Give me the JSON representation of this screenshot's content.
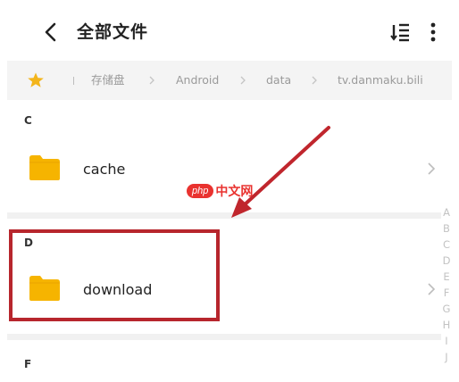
{
  "header": {
    "title": "全部文件"
  },
  "breadcrumb": {
    "items": [
      "存储盘",
      "Android",
      "data",
      "tv.danmaku.bili"
    ]
  },
  "sections": [
    {
      "letter": "C",
      "folder": "cache"
    },
    {
      "letter": "D",
      "folder": "download"
    },
    {
      "letter": "F"
    }
  ],
  "alphabet_index": [
    "A",
    "B",
    "C",
    "D",
    "E",
    "F",
    "G",
    "H",
    "I",
    "J"
  ],
  "watermark": {
    "badge": "php",
    "text": "中文网"
  },
  "colors": {
    "folder": "#f6b400",
    "highlight": "#b7262d",
    "star": "#f3b51c",
    "breadcrumb_bg": "#f4f4f4"
  }
}
